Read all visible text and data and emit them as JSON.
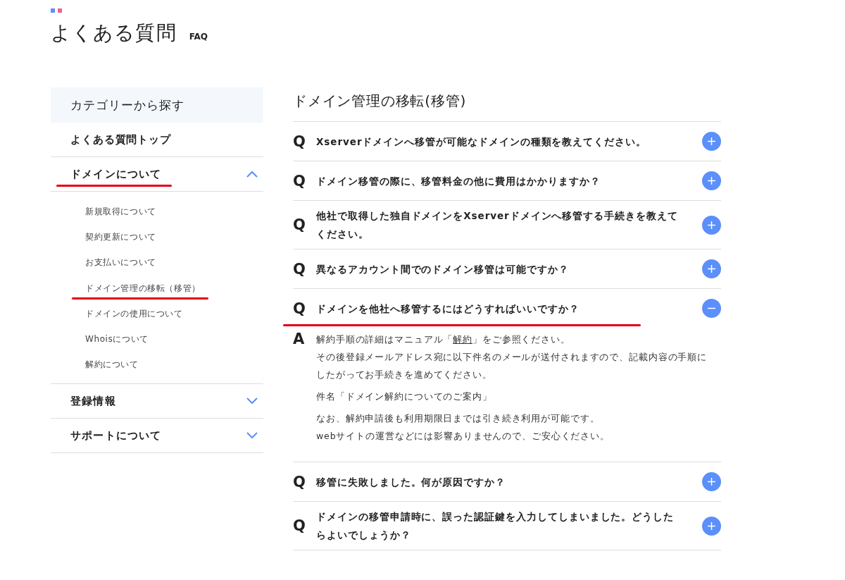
{
  "page_title": "よくある質問",
  "page_subtitle": "FAQ",
  "sidebar": {
    "header": "カテゴリーから探す",
    "top_link": {
      "label": "よくある質問トップ"
    },
    "categories": [
      {
        "label": "ドメインについて",
        "expanded": true,
        "underlined": true,
        "children": [
          {
            "label": "新規取得について",
            "underlined": false
          },
          {
            "label": "契約更新について",
            "underlined": false
          },
          {
            "label": "お支払いについて",
            "underlined": false
          },
          {
            "label": "ドメイン管理の移転（移管）",
            "underlined": true
          },
          {
            "label": "ドメインの使用について",
            "underlined": false
          },
          {
            "label": "Whoisについて",
            "underlined": false
          },
          {
            "label": "解約について",
            "underlined": false
          }
        ]
      },
      {
        "label": "登録情報",
        "expanded": false,
        "underlined": false
      },
      {
        "label": "サポートについて",
        "expanded": false,
        "underlined": false
      }
    ]
  },
  "section_title": "ドメイン管理の移転(移管)",
  "faqs": [
    {
      "q_mark": "Q",
      "question": "Xserverドメインへ移管が可能なドメインの種類を教えてください。",
      "expanded": false,
      "underlined": false
    },
    {
      "q_mark": "Q",
      "question": "ドメイン移管の際に、移管料金の他に費用はかかりますか？",
      "expanded": false,
      "underlined": false
    },
    {
      "q_mark": "Q",
      "question": "他社で取得した独自ドメインをXserverドメインへ移管する手続きを教えてください。",
      "expanded": false,
      "underlined": false
    },
    {
      "q_mark": "Q",
      "question": "異なるアカウント間でのドメイン移管は可能ですか？",
      "expanded": false,
      "underlined": false
    },
    {
      "q_mark": "Q",
      "question": "ドメインを他社へ移管するにはどうすればいいですか？",
      "expanded": true,
      "underlined": true,
      "answer": {
        "a_mark": "A",
        "paragraphs": [
          {
            "lines": [
              {
                "before": "解約手順の詳細はマニュアル「",
                "link": "解約",
                "after": "」をご参照ください。"
              },
              {
                "before": "その後登録メールアドレス宛に以下件名のメールが送付されますので、記載内容の手順にしたがってお手続きを進めてください。"
              }
            ]
          },
          {
            "lines": [
              {
                "before": "件名「ドメイン解約についてのご案内」"
              }
            ]
          },
          {
            "lines": [
              {
                "before": "なお、解約申請後も利用期限日までは引き続き利用が可能です。"
              },
              {
                "before": "webサイトの運営などには影響ありませんので、ご安心ください。"
              }
            ]
          }
        ]
      }
    },
    {
      "q_mark": "Q",
      "question": "移管に失敗しました。何が原因ですか？",
      "expanded": false,
      "underlined": false
    },
    {
      "q_mark": "Q",
      "question": "ドメインの移管申請時に、誤った認証鍵を入力してしまいました。どうしたらよいでしょうか？",
      "expanded": false,
      "underlined": false
    }
  ]
}
